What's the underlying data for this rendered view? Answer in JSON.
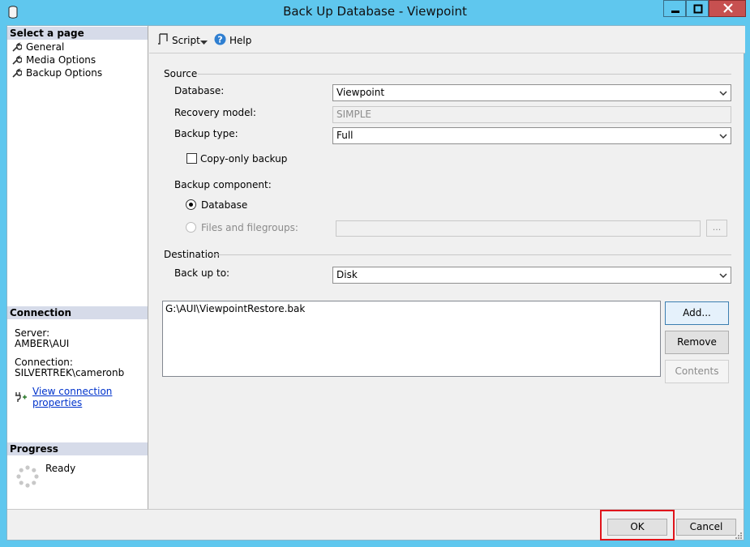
{
  "window": {
    "title": "Back Up Database - Viewpoint",
    "minimize_glyph": "▬",
    "maximize_glyph": "□",
    "close_glyph": "✕"
  },
  "left": {
    "select_page_header": "Select a page",
    "pages": [
      {
        "label": "General",
        "icon": "wrench-icon"
      },
      {
        "label": "Media Options",
        "icon": "wrench-icon"
      },
      {
        "label": "Backup Options",
        "icon": "wrench-icon"
      }
    ],
    "connection_header": "Connection",
    "server_label": "Server:",
    "server_value": "AMBER\\AUI",
    "connection_label": "Connection:",
    "connection_value": "SILVERTREK\\cameronb",
    "view_connection_link": "View connection properties",
    "progress_header": "Progress",
    "progress_status": "Ready"
  },
  "toolbar": {
    "script_label": "Script",
    "help_label": "Help"
  },
  "source": {
    "group_label": "Source",
    "database_label": "Database:",
    "database_value": "Viewpoint",
    "recovery_label": "Recovery model:",
    "recovery_value": "SIMPLE",
    "backup_type_label": "Backup type:",
    "backup_type_value": "Full",
    "copy_only_label": "Copy-only backup",
    "copy_only_checked": false,
    "component_label": "Backup component:",
    "component_database": "Database",
    "component_files": "Files and filegroups:",
    "browse_label": "..."
  },
  "destination": {
    "group_label": "Destination",
    "back_up_to_label": "Back up to:",
    "back_up_to_value": "Disk",
    "paths": [
      "G:\\AUI\\ViewpointRestore.bak"
    ],
    "add_label": "Add...",
    "remove_label": "Remove",
    "contents_label": "Contents"
  },
  "footer": {
    "ok_label": "OK",
    "cancel_label": "Cancel",
    "highlight_color": "#e0141b"
  }
}
